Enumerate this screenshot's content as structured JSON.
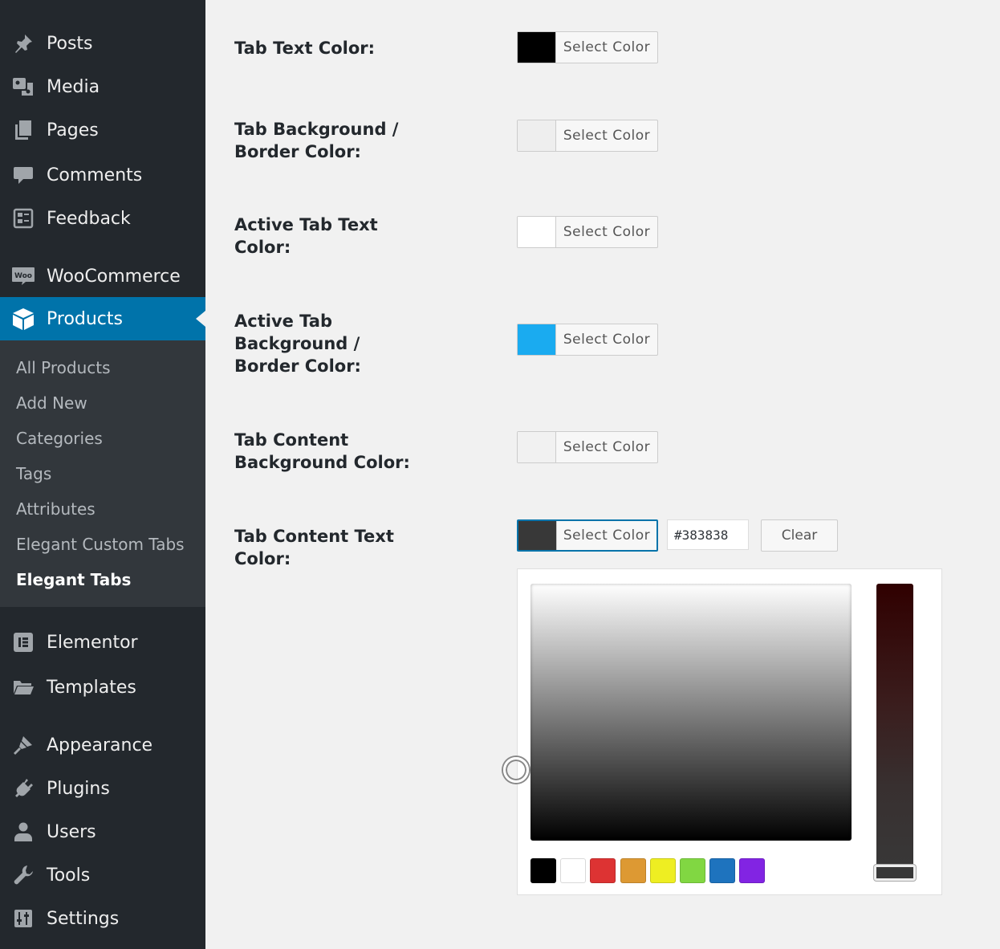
{
  "sidebar": {
    "items": [
      {
        "label": "Posts",
        "icon": "pushpin-icon"
      },
      {
        "label": "Media",
        "icon": "media-icon"
      },
      {
        "label": "Pages",
        "icon": "pages-icon"
      },
      {
        "label": "Comments",
        "icon": "comment-icon"
      },
      {
        "label": "Feedback",
        "icon": "feedback-icon"
      },
      {
        "label": "WooCommerce",
        "icon": "woo-icon",
        "icon_text": "Woo"
      },
      {
        "label": "Products",
        "icon": "box-icon",
        "active": true
      },
      {
        "label": "Elementor",
        "icon": "elementor-icon"
      },
      {
        "label": "Templates",
        "icon": "folder-icon"
      },
      {
        "label": "Appearance",
        "icon": "brush-icon"
      },
      {
        "label": "Plugins",
        "icon": "plug-icon"
      },
      {
        "label": "Users",
        "icon": "user-icon"
      },
      {
        "label": "Tools",
        "icon": "wrench-icon"
      },
      {
        "label": "Settings",
        "icon": "sliders-icon"
      }
    ],
    "submenu": [
      {
        "label": "All Products"
      },
      {
        "label": "Add New"
      },
      {
        "label": "Categories"
      },
      {
        "label": "Tags"
      },
      {
        "label": "Attributes"
      },
      {
        "label": "Elegant Custom Tabs"
      },
      {
        "label": "Elegant Tabs",
        "current": true
      }
    ],
    "active_color": "#0073aa"
  },
  "settings": [
    {
      "label": "Tab Text Color:",
      "button": "Select Color",
      "color": "#000000"
    },
    {
      "label": "Tab Background / Border Color:",
      "button": "Select Color",
      "color": "#eeeeee"
    },
    {
      "label": "Active Tab Text Color:",
      "button": "Select Color",
      "color": "#ffffff"
    },
    {
      "label": "Active Tab Background / Border Color:",
      "button": "Select Color",
      "color": "#1aabf0"
    },
    {
      "label": "Tab Content Background Color:",
      "button": "Select Color",
      "color": "#f1f1f1"
    },
    {
      "label": "Tab Content Text Color:",
      "button": "Select Color",
      "color": "#383838"
    }
  ],
  "color_picker": {
    "hex_value": "#383838",
    "clear_label": "Clear",
    "palette": [
      "#000000",
      "#ffffff",
      "#dd3333",
      "#dd9933",
      "#eeee22",
      "#81d742",
      "#1e73be",
      "#8224e3"
    ]
  }
}
